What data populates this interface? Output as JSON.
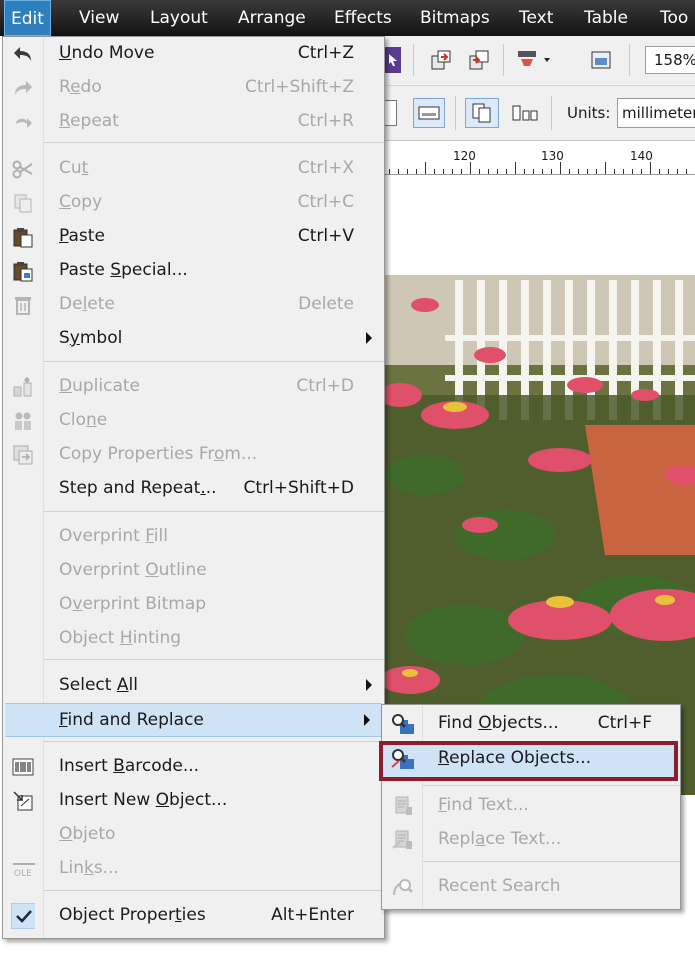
{
  "menubar": {
    "items": [
      "Edit",
      "View",
      "Layout",
      "Arrange",
      "Effects",
      "Bitmaps",
      "Text",
      "Table",
      "Too"
    ]
  },
  "toolbar": {
    "zoom": "158%",
    "units_label": "Units:",
    "units_value": "millimeters"
  },
  "ruler": {
    "labels": [
      "120",
      "130",
      "140"
    ]
  },
  "edit_menu": {
    "items": [
      {
        "label": "Undo Move",
        "shortcut": "Ctrl+Z",
        "icon": "undo-icon",
        "enabled": true
      },
      {
        "label": "Redo",
        "shortcut": "Ctrl+Shift+Z",
        "icon": "redo-icon",
        "enabled": false
      },
      {
        "label": "Repeat",
        "shortcut": "Ctrl+R",
        "icon": "repeat-icon",
        "enabled": false
      },
      {
        "label": "Cut",
        "shortcut": "Ctrl+X",
        "icon": "scissors-icon",
        "enabled": false
      },
      {
        "label": "Copy",
        "shortcut": "Ctrl+C",
        "icon": "copy-icon",
        "enabled": false
      },
      {
        "label": "Paste",
        "shortcut": "Ctrl+V",
        "icon": "paste-icon",
        "enabled": true
      },
      {
        "label": "Paste Special...",
        "shortcut": "",
        "icon": "paste-special-icon",
        "enabled": true
      },
      {
        "label": "Delete",
        "shortcut": "Delete",
        "icon": "trash-icon",
        "enabled": false
      },
      {
        "label": "Symbol",
        "shortcut": "",
        "icon": "",
        "enabled": true
      },
      {
        "label": "Duplicate",
        "shortcut": "Ctrl+D",
        "icon": "duplicate-icon",
        "enabled": false
      },
      {
        "label": "Clone",
        "shortcut": "",
        "icon": "clone-icon",
        "enabled": false
      },
      {
        "label": "Copy Properties From...",
        "shortcut": "",
        "icon": "copy-properties-icon",
        "enabled": false
      },
      {
        "label": "Step and Repeat...",
        "shortcut": "Ctrl+Shift+D",
        "icon": "",
        "enabled": true
      },
      {
        "label": "Overprint Fill",
        "shortcut": "",
        "icon": "",
        "enabled": false
      },
      {
        "label": "Overprint Outline",
        "shortcut": "",
        "icon": "",
        "enabled": false
      },
      {
        "label": "Overprint Bitmap",
        "shortcut": "",
        "icon": "",
        "enabled": false
      },
      {
        "label": "Object Hinting",
        "shortcut": "",
        "icon": "",
        "enabled": false
      },
      {
        "label": "Select All",
        "shortcut": "",
        "icon": "",
        "enabled": true
      },
      {
        "label": "Find and Replace",
        "shortcut": "",
        "icon": "",
        "enabled": true
      },
      {
        "label": "Insert Barcode...",
        "shortcut": "",
        "icon": "barcode-icon",
        "enabled": true
      },
      {
        "label": "Insert New Object...",
        "shortcut": "",
        "icon": "insert-object-icon",
        "enabled": true
      },
      {
        "label": "Objeto",
        "shortcut": "",
        "icon": "",
        "enabled": false
      },
      {
        "label": "Links...",
        "shortcut": "",
        "icon": "ole-icon",
        "enabled": false
      },
      {
        "label": "Object Properties",
        "shortcut": "Alt+Enter",
        "icon": "checkmark-icon",
        "enabled": true
      }
    ]
  },
  "submenu": {
    "items": [
      {
        "label": "Find Objects...",
        "shortcut": "Ctrl+F",
        "icon": "find-objects-icon",
        "enabled": true
      },
      {
        "label": "Replace Objects...",
        "shortcut": "",
        "icon": "replace-objects-icon",
        "enabled": true
      },
      {
        "label": "Find Text...",
        "shortcut": "",
        "icon": "find-text-icon",
        "enabled": false
      },
      {
        "label": "Replace Text...",
        "shortcut": "",
        "icon": "replace-text-icon",
        "enabled": false
      },
      {
        "label": "Recent Search",
        "shortcut": "",
        "icon": "recent-search-icon",
        "enabled": false
      }
    ]
  },
  "colors": {
    "menubar_bg": "#1e1e1e",
    "menu_bg": "#f0f0f0",
    "highlight": "#cfe3f7",
    "callout_border": "#8c1c2e",
    "disabled_text": "#a8a8a8"
  }
}
